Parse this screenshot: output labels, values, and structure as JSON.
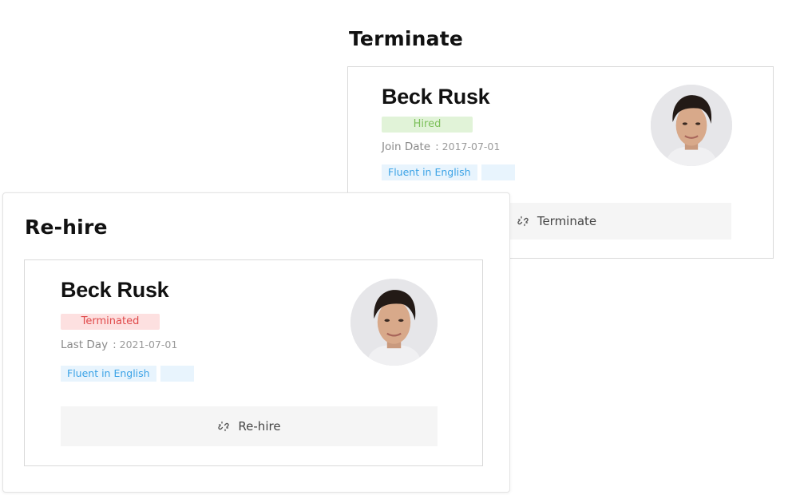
{
  "terminate_panel": {
    "title": "Terminate",
    "employee": {
      "name": "Beck Rusk",
      "status": "Hired",
      "date_label": "Join Date",
      "date_separator": ":",
      "date_value": "2017-07-01",
      "tags": [
        "Fluent in English",
        ""
      ],
      "avatar_icon": "user-avatar-photo"
    },
    "action_label": "Terminate",
    "action_icon": "unlink-icon"
  },
  "rehire_panel": {
    "title": "Re-hire",
    "employee": {
      "name": "Beck Rusk",
      "status": "Terminated",
      "date_label": "Last Day",
      "date_separator": ":",
      "date_value": "2021-07-01",
      "tags": [
        "Fluent in English",
        ""
      ],
      "avatar_icon": "user-avatar-photo"
    },
    "action_label": "Re-hire",
    "action_icon": "unlink-icon"
  },
  "colors": {
    "hired_badge_bg": "#e1f3d8",
    "hired_badge_text": "#7cc05a",
    "terminated_badge_bg": "#fde0e0",
    "terminated_badge_text": "#e0494a",
    "tag_bg": "#e8f4fd",
    "tag_text": "#3aa2e6",
    "button_bg": "#f5f5f5"
  }
}
